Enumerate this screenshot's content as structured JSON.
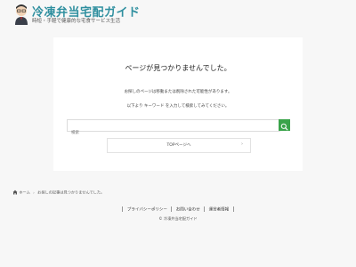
{
  "site": {
    "title": "冷凍弁当宅配ガイド",
    "tagline": "時短・手軽で健康的な宅食サービス生活"
  },
  "notfound": {
    "title": "ページが見つかりませんでした。",
    "text1": "お探しのページは移動または削除された可能性があります。",
    "text2": "以下より キーワード を入力して検索してみてください。"
  },
  "search": {
    "placeholder": "検索",
    "button_icon": "search-icon"
  },
  "top_button": {
    "label": "TOPページへ",
    "icon": "chevron-right-icon"
  },
  "breadcrumb": {
    "home": "ホーム",
    "current": "お探しの記事は見つかりませんでした。"
  },
  "footer": {
    "links": [
      "プライバシーポリシー",
      "お問い合わせ",
      "運営者情報"
    ],
    "copyright": "© 冷凍弁当宅配ガイド"
  },
  "colors": {
    "accent_title": "#2f8f9f",
    "search_button": "#3aa34a",
    "background": "#f7f7f7"
  }
}
